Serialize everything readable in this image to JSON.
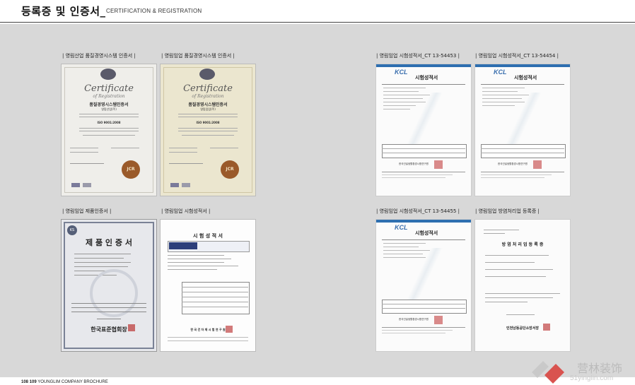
{
  "header": {
    "title_ko": "등록증 및 인증서_",
    "title_en": "CERTIFICATION & REGISTRATION"
  },
  "captions": [
    "| 영림산업 품질경영시스템 인증서 |",
    "| 영림임업 품질경영시스템 인증서 |",
    "| 영림임업 시험성적서_CT 13-54453 |",
    "| 영림임업 시험성적서_CT 13-54454 |",
    "| 영림임업 제품인증서 |",
    "| 영림임업 시험성적서 |",
    "| 영림임업 시험성적서_CT 13-54455 |",
    "| 영림임업 방염처리업 등록증 |"
  ],
  "documents": {
    "cert1": {
      "heading": "Certificate",
      "sub": "of Registration",
      "korean": "품질경영시스템인증서",
      "company": "영림산업(주)",
      "standard": "ISO 9001:2008",
      "badge": "JCR"
    },
    "cert2": {
      "heading": "Certificate",
      "sub": "of Registration",
      "korean": "품질경영시스템인증서",
      "company": "영림임업(주)",
      "standard": "ISO 9001:2008",
      "badge": "JCR"
    },
    "test1": {
      "logo": "KCL",
      "title": "시험성적서",
      "org": "한국건설생활환경시험연구원"
    },
    "test2": {
      "logo": "KCL",
      "title": "시험성적서",
      "org": "한국건설생활환경시험연구원"
    },
    "product": {
      "logo": "KS",
      "title": "제 품 인 증 서",
      "issuer": "한국표준협회장"
    },
    "test3": {
      "title": "시 험 성 적 서",
      "issuer": "한 국 건 자 재 시 험 연 구 원"
    },
    "test4": {
      "logo": "KCL",
      "title": "시험성적서",
      "org": "한국건설생활환경시험연구원"
    },
    "flame": {
      "title": "방 염 처 리 업  등 록 증",
      "issuer": "인천남동공단소방서장"
    }
  },
  "footer": {
    "pages": "108 109",
    "brand": "YOUNGLIM COMPANY BROCHURE"
  },
  "watermark": {
    "text": "营林装饰",
    "url": "51yinglin.com"
  }
}
